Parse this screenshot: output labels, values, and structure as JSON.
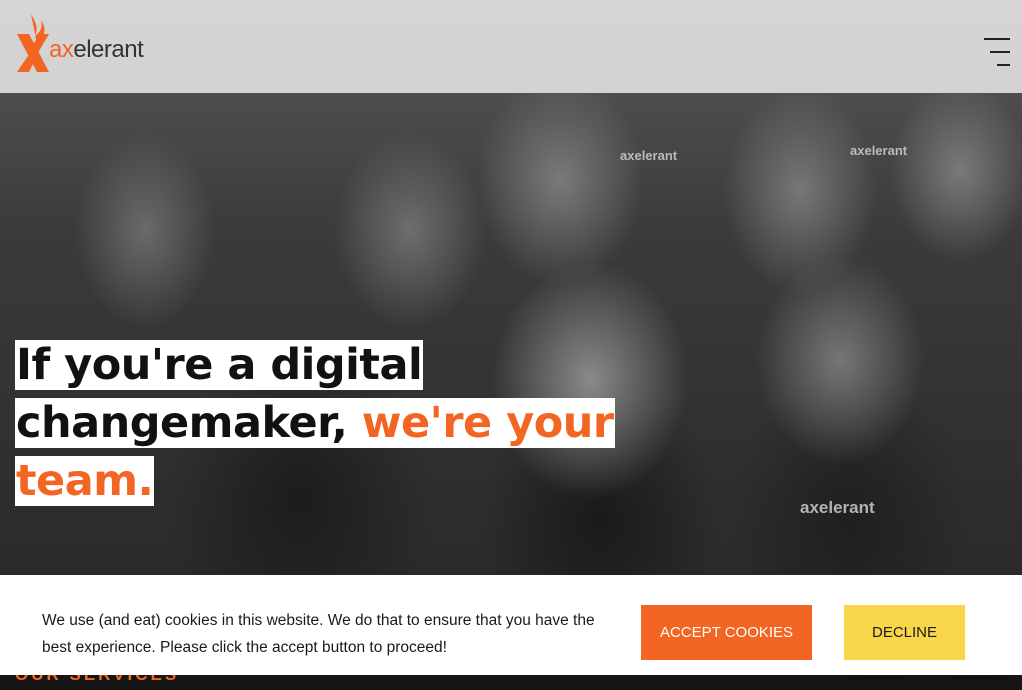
{
  "header": {
    "logo_text_accent": "ax",
    "logo_text_rest": "elerant"
  },
  "hero": {
    "shirt_logo": "axelerant",
    "headline_line1": "If you're a digital",
    "headline_line2_plain": "changemaker, ",
    "headline_line2_accent": "we're your",
    "headline_line3_accent": "team."
  },
  "services": {
    "title": "OUR SERVICES"
  },
  "cookie_banner": {
    "message": "We use (and eat) cookies in this website. We do that to ensure that you have the best experience. Please click the accept button to proceed!",
    "accept_label": "ACCEPT COOKIES",
    "decline_label": "DECLINE"
  },
  "colors": {
    "brand_orange": "#f26522",
    "decline_yellow": "#f7d64a"
  },
  "icons": [
    "axelerant-logo-icon",
    "hamburger-menu-icon",
    "arrow-left-icon",
    "arrow-right-icon"
  ]
}
